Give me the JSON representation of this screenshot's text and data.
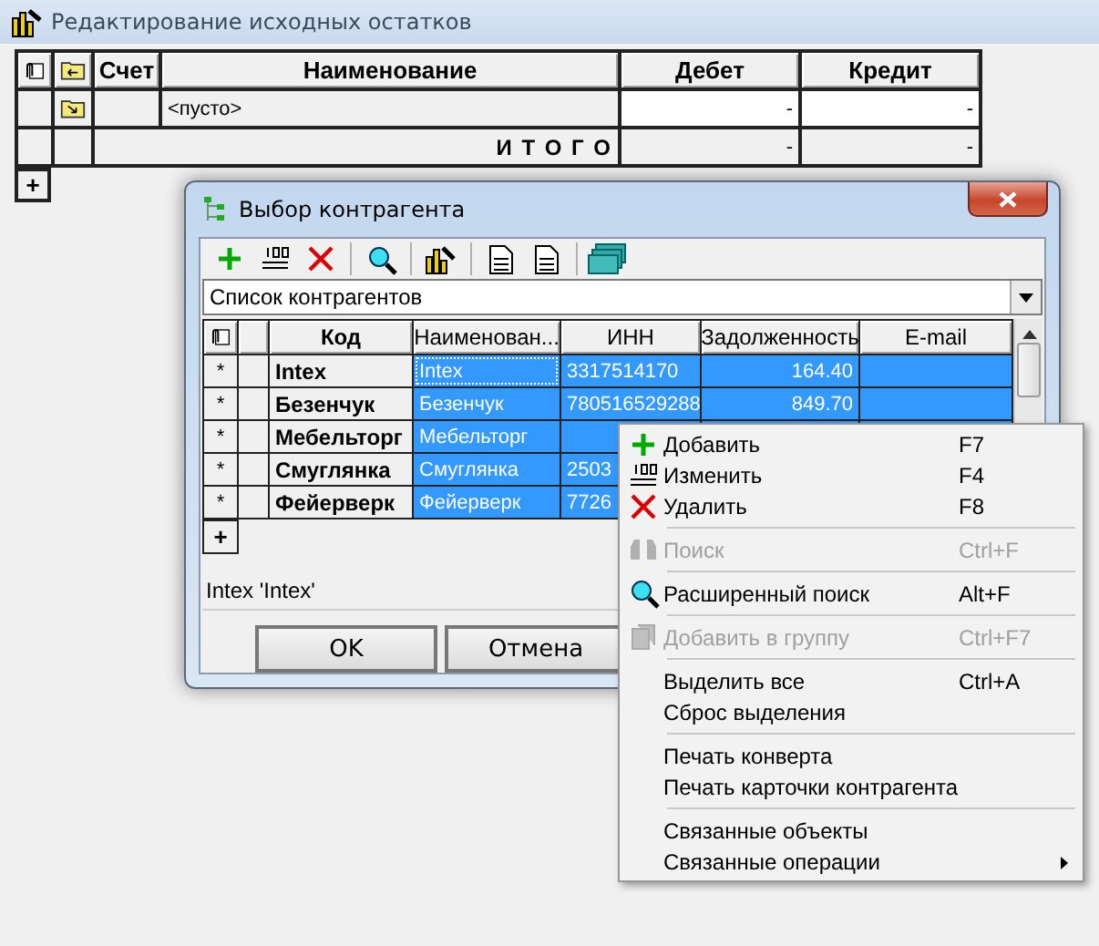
{
  "window": {
    "title": "Редактирование исходных остатков"
  },
  "balances_table": {
    "columns": [
      "Счет",
      "Наименование",
      "Дебет",
      "Кредит"
    ],
    "rows": [
      {
        "name": "<пусто>",
        "debit": "-",
        "credit": "-"
      }
    ],
    "total": {
      "label": "И Т О Г О",
      "debit": "-",
      "credit": "-"
    },
    "add_row": "+"
  },
  "dialog": {
    "title": "Выбор контрагента",
    "list_selector": "Список контрагентов",
    "columns": [
      "Код",
      "Наименован...",
      "ИНН",
      "Задолженность",
      "E-mail"
    ],
    "rows": [
      {
        "marker": "*",
        "code": "Intex",
        "name": "Intex",
        "inn": "3317514170",
        "debt": "164.40",
        "selected": true
      },
      {
        "marker": "*",
        "code": "Безенчук",
        "name": "Безенчук",
        "inn": "780516529288",
        "debt": "849.70",
        "selected": true
      },
      {
        "marker": "*",
        "code": "Мебельторг",
        "name": "Мебельторг",
        "inn": "",
        "debt": "",
        "selected": true
      },
      {
        "marker": "*",
        "code": "Смуглянка",
        "name": "Смуглянка",
        "inn": "2503",
        "debt": "",
        "selected": true
      },
      {
        "marker": "*",
        "code": "Фейерверк",
        "name": "Фейерверк",
        "inn": "7726",
        "debt": "",
        "selected": true
      }
    ],
    "add_row": "+",
    "status": "Intex 'Intex'",
    "buttons": [
      "OK",
      "Отмена"
    ]
  },
  "context_menu": {
    "items": [
      {
        "kind": "item",
        "label": "Добавить",
        "shortcut": "F7",
        "disabled": false
      },
      {
        "kind": "item",
        "label": "Изменить",
        "shortcut": "F4",
        "disabled": false
      },
      {
        "kind": "item",
        "label": "Удалить",
        "shortcut": "F8",
        "disabled": false
      },
      {
        "kind": "separator"
      },
      {
        "kind": "item",
        "label": "Поиск",
        "shortcut": "Ctrl+F",
        "disabled": true
      },
      {
        "kind": "separator"
      },
      {
        "kind": "item",
        "label": "Расширенный поиск",
        "shortcut": "Alt+F",
        "disabled": false
      },
      {
        "kind": "separator"
      },
      {
        "kind": "item",
        "label": "Добавить в группу",
        "shortcut": "Ctrl+F7",
        "disabled": true
      },
      {
        "kind": "separator"
      },
      {
        "kind": "item",
        "label": "Выделить все",
        "shortcut": "Ctrl+A",
        "disabled": false
      },
      {
        "kind": "item",
        "label": "Сброс выделения",
        "disabled": false
      },
      {
        "kind": "separator"
      },
      {
        "kind": "item",
        "label": "Печать конверта",
        "disabled": false
      },
      {
        "kind": "item",
        "label": "Печать карточки контрагента",
        "disabled": false
      },
      {
        "kind": "separator"
      },
      {
        "kind": "item",
        "label": "Связанные объекты",
        "disabled": false
      },
      {
        "kind": "item",
        "label": "Связанные операции",
        "disabled": false,
        "submenu": true
      }
    ]
  }
}
